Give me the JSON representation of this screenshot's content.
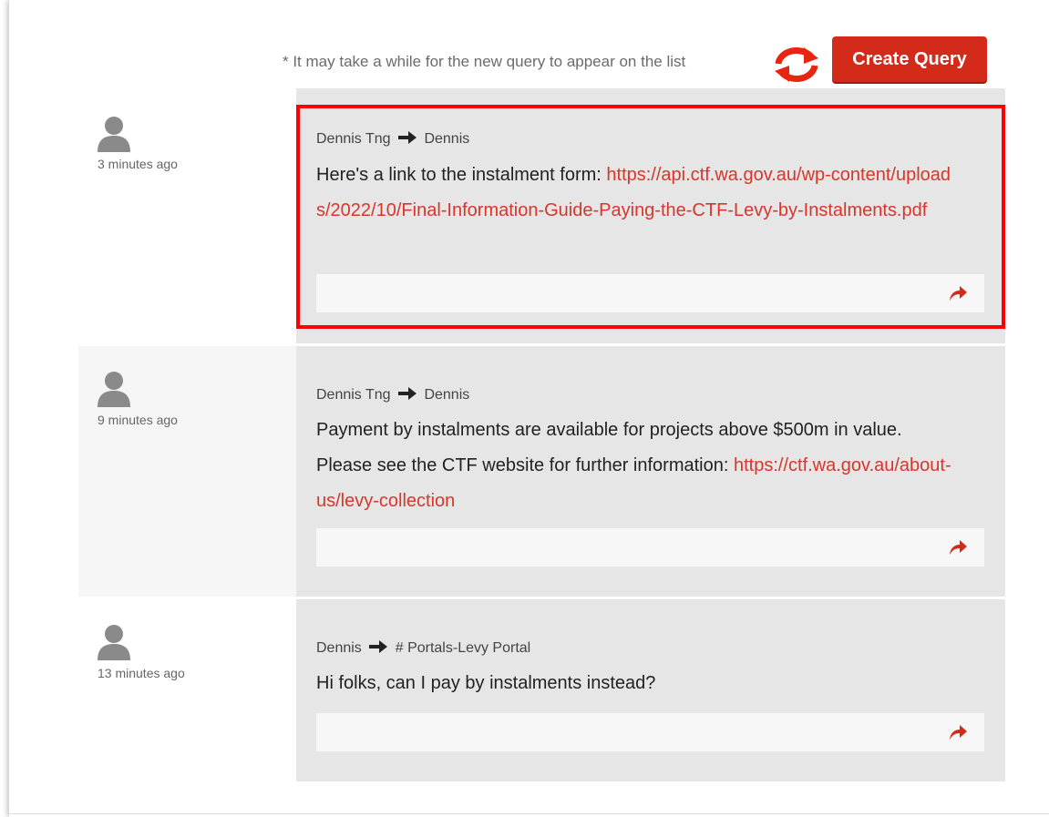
{
  "header": {
    "note": "* It may take a while for the new query to appear on the list",
    "create_query_label": "Create Query",
    "refresh_icon": "refresh-icon"
  },
  "colors": {
    "accent": "#d42a1a",
    "link": "#d9352a",
    "highlight_border": "#ff0000",
    "card_bg": "#e6e6e6"
  },
  "messages": [
    {
      "time": "3 minutes ago",
      "sender": "Dennis Tng",
      "recipient": "Dennis",
      "text": "Here's a link to the instalment form: ",
      "link": "https://api.ctf.wa.gov.au/wp-content/uploads/2022/10/Final-Information-Guide-Paying-the-CTF-Levy-by-Instalments.pdf",
      "highlighted": true
    },
    {
      "time": "9 minutes ago",
      "sender": "Dennis Tng",
      "recipient": "Dennis",
      "text": "Payment by instalments are available for projects above $500m in value. Please see the CTF website for further information: ",
      "link": "https://ctf.wa.gov.au/about-us/levy-collection",
      "highlighted": false
    },
    {
      "time": "13 minutes ago",
      "sender": "Dennis",
      "recipient": "# Portals-Levy Portal",
      "text": "Hi folks, can I pay by instalments instead?",
      "link": "",
      "highlighted": false
    }
  ]
}
